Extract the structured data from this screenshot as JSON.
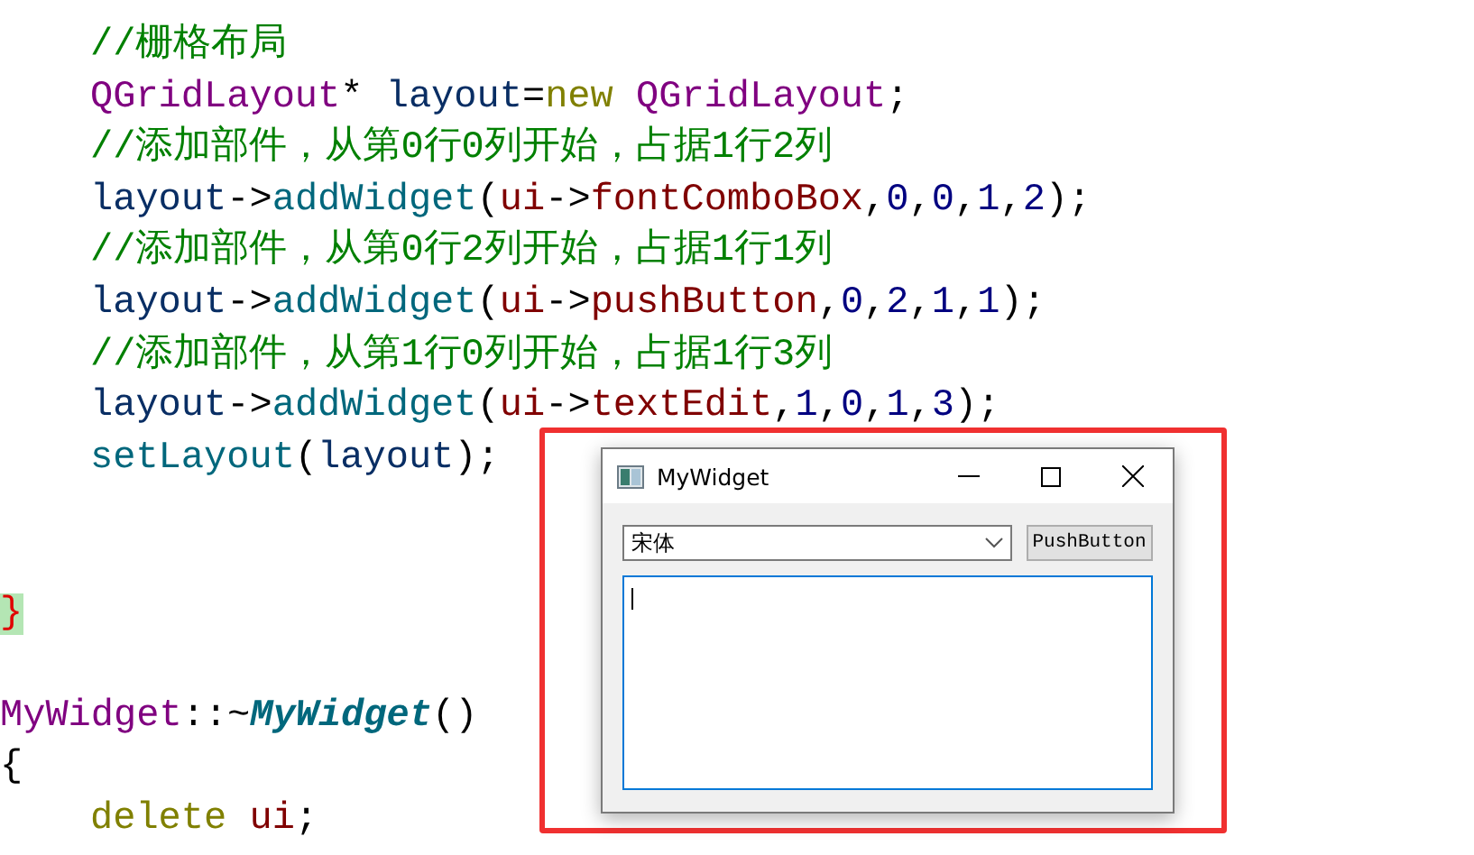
{
  "editor": {
    "blocks": [
      {
        "lines": [
          {
            "indented": true,
            "tokens": [
              {
                "text": "//栅格布局",
                "kind": "comment"
              }
            ]
          },
          {
            "indented": true,
            "tokens": [
              {
                "text": "QGridLayout",
                "kind": "type"
              },
              {
                "text": "* ",
                "kind": "plain"
              },
              {
                "text": "layout",
                "kind": "var"
              },
              {
                "text": "=",
                "kind": "plain"
              },
              {
                "text": "new ",
                "kind": "keyword"
              },
              {
                "text": "QGridLayout",
                "kind": "type"
              },
              {
                "text": ";",
                "kind": "plain"
              }
            ]
          },
          {
            "indented": true,
            "tokens": [
              {
                "text": "//添加部件，从第0行0列开始，占据1行2列",
                "kind": "comment"
              }
            ]
          },
          {
            "indented": true,
            "tokens": [
              {
                "text": "layout",
                "kind": "var"
              },
              {
                "text": "->",
                "kind": "plain"
              },
              {
                "text": "addWidget",
                "kind": "func"
              },
              {
                "text": "(",
                "kind": "plain"
              },
              {
                "text": "ui",
                "kind": "member"
              },
              {
                "text": "->",
                "kind": "plain"
              },
              {
                "text": "fontComboBox",
                "kind": "member"
              },
              {
                "text": ",",
                "kind": "plain"
              },
              {
                "text": "0",
                "kind": "number"
              },
              {
                "text": ",",
                "kind": "plain"
              },
              {
                "text": "0",
                "kind": "number"
              },
              {
                "text": ",",
                "kind": "plain"
              },
              {
                "text": "1",
                "kind": "number"
              },
              {
                "text": ",",
                "kind": "plain"
              },
              {
                "text": "2",
                "kind": "number"
              },
              {
                "text": ");",
                "kind": "plain"
              }
            ]
          },
          {
            "indented": true,
            "tokens": [
              {
                "text": "//添加部件，从第0行2列开始，占据1行1列",
                "kind": "comment"
              }
            ]
          },
          {
            "indented": true,
            "tokens": [
              {
                "text": "layout",
                "kind": "var"
              },
              {
                "text": "->",
                "kind": "plain"
              },
              {
                "text": "addWidget",
                "kind": "func"
              },
              {
                "text": "(",
                "kind": "plain"
              },
              {
                "text": "ui",
                "kind": "member"
              },
              {
                "text": "->",
                "kind": "plain"
              },
              {
                "text": "pushButton",
                "kind": "member"
              },
              {
                "text": ",",
                "kind": "plain"
              },
              {
                "text": "0",
                "kind": "number"
              },
              {
                "text": ",",
                "kind": "plain"
              },
              {
                "text": "2",
                "kind": "number"
              },
              {
                "text": ",",
                "kind": "plain"
              },
              {
                "text": "1",
                "kind": "number"
              },
              {
                "text": ",",
                "kind": "plain"
              },
              {
                "text": "1",
                "kind": "number"
              },
              {
                "text": ");",
                "kind": "plain"
              }
            ]
          },
          {
            "indented": true,
            "tokens": [
              {
                "text": "//添加部件，从第1行0列开始，占据1行3列",
                "kind": "comment"
              }
            ]
          },
          {
            "indented": true,
            "tokens": [
              {
                "text": "layout",
                "kind": "var"
              },
              {
                "text": "->",
                "kind": "plain"
              },
              {
                "text": "addWidget",
                "kind": "func"
              },
              {
                "text": "(",
                "kind": "plain"
              },
              {
                "text": "ui",
                "kind": "member"
              },
              {
                "text": "->",
                "kind": "plain"
              },
              {
                "text": "textEdit",
                "kind": "member"
              },
              {
                "text": ",",
                "kind": "plain"
              },
              {
                "text": "1",
                "kind": "number"
              },
              {
                "text": ",",
                "kind": "plain"
              },
              {
                "text": "0",
                "kind": "number"
              },
              {
                "text": ",",
                "kind": "plain"
              },
              {
                "text": "1",
                "kind": "number"
              },
              {
                "text": ",",
                "kind": "plain"
              },
              {
                "text": "3",
                "kind": "number"
              },
              {
                "text": ");",
                "kind": "plain"
              }
            ]
          },
          {
            "indented": true,
            "tokens": [
              {
                "text": "setLayout",
                "kind": "func"
              },
              {
                "text": "(",
                "kind": "plain"
              },
              {
                "text": "layout",
                "kind": "var"
              },
              {
                "text": ");",
                "kind": "plain"
              }
            ]
          }
        ]
      },
      {
        "lines": [
          {
            "indented": false,
            "tokens": [
              {
                "text": "}",
                "kind": "brace-match"
              }
            ]
          }
        ]
      },
      {
        "lines": [
          {
            "indented": false,
            "tokens": [
              {
                "text": "MyWidget",
                "kind": "type"
              },
              {
                "text": "::~",
                "kind": "plain"
              },
              {
                "text": "MyWidget",
                "kind": "func-def"
              },
              {
                "text": "()",
                "kind": "plain"
              }
            ]
          },
          {
            "indented": false,
            "tokens": [
              {
                "text": "{",
                "kind": "plain"
              }
            ]
          },
          {
            "indented": true,
            "tokens": [
              {
                "text": "delete ",
                "kind": "keyword"
              },
              {
                "text": "ui",
                "kind": "member"
              },
              {
                "text": ";",
                "kind": "plain"
              }
            ]
          }
        ]
      }
    ]
  },
  "dialog": {
    "title": "MyWidget",
    "combo": {
      "value": "宋体"
    },
    "button": "PushButton",
    "text_edit": {
      "focused": true
    }
  }
}
